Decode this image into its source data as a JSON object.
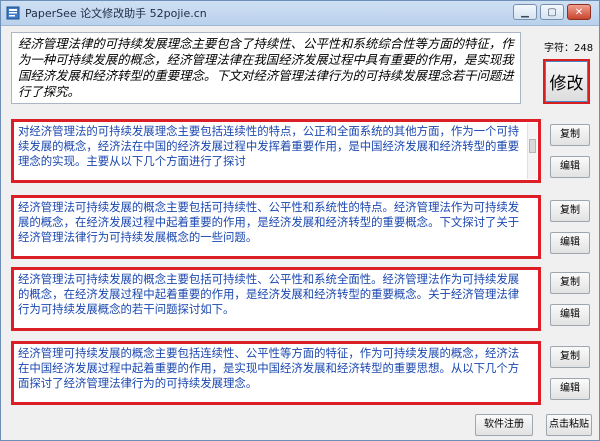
{
  "window": {
    "title": "PaperSee 论文修改助手 52pojie.cn",
    "min_glyph": "▁",
    "max_glyph": "▢",
    "close_glyph": "✕"
  },
  "main": {
    "text": "经济管理法律的可持续发展理念主要包含了持续性、公平性和系统综合性等方面的特征，作为一种可持续发展的概念，经济管理法律在我国经济发展过程中具有重要的作用，是实现我国经济发展和经济转型的重要理念。下文对经济管理法律行为的可持续发展理念若干问题进行了探究。",
    "char_count_label": "字符：248",
    "modify_button": "修改"
  },
  "results": [
    {
      "text": "对经济管理法的可持续发展理念主要包括连续性的特点，公正和全面系统的其他方面，作为一个可持续发展的概念，经济法在中国的经济发展过程中发挥着重要作用，是中国经济发展和经济转型的重要理念的实现。主要从以下几个方面进行了探讨",
      "copy": "复制",
      "edit": "编辑"
    },
    {
      "text": "经济管理法可持续发展的概念主要包括可持续性、公平性和系统性的特点。经济管理法作为可持续发展的概念，在经济发展过程中起着重要的作用，是经济发展和经济转型的重要概念。下文探讨了关于经济管理法律行为可持续发展概念的一些问题。",
      "copy": "复制",
      "edit": "编辑"
    },
    {
      "text": "经济管理法可持续发展的概念主要包括可持续性、公平性和系统全面性。经济管理法作为可持续发展的概念，在经济发展过程中起着重要的作用，是经济发展和经济转型的重要概念。关于经济管理法律行为可持续发展概念的若干问题探讨如下。",
      "copy": "复制",
      "edit": "编辑"
    },
    {
      "text": "经济管理可持续发展的概念主要包括连续性、公平性等方面的特征，作为可持续发展的概念，经济法在中国经济发展过程中起着重要的作用，是实现中国经济发展和经济转型的重要思想。从以下几个方面探讨了经济管理法律行为的可持续发展理念。",
      "copy": "复制",
      "edit": "编辑"
    }
  ],
  "footer": {
    "register_button": "软件注册",
    "paste_button": "点击粘贴"
  },
  "colors": {
    "highlight_border": "#dc1f26",
    "result_text": "#1a47b0"
  }
}
